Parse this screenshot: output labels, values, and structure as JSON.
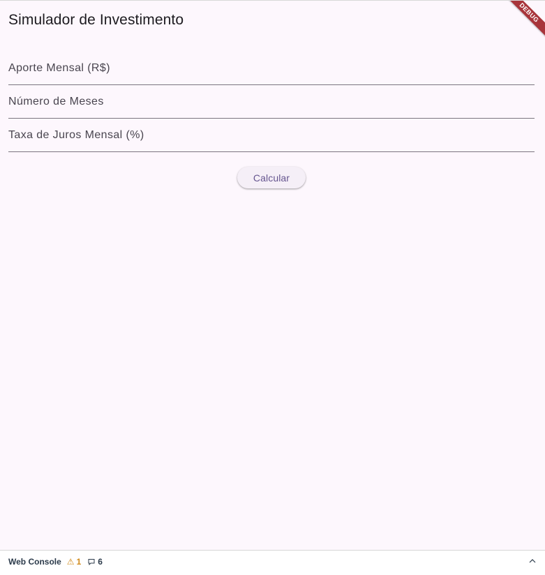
{
  "app": {
    "title": "Simulador de Investimento"
  },
  "form": {
    "fields": [
      {
        "label": "Aporte Mensal (R$)",
        "value": ""
      },
      {
        "label": "Número de Meses",
        "value": ""
      },
      {
        "label": "Taxa de Juros Mensal (%)",
        "value": ""
      }
    ],
    "calculate_label": "Calcular"
  },
  "debug_banner": {
    "label": "DEBUG",
    "color": "#a8343a"
  },
  "console": {
    "title": "Web Console",
    "warning_count": "1",
    "message_count": "6",
    "warning_icon": "warning-triangle-icon",
    "message_icon": "speech-bubble-icon",
    "toggle_icon": "chevron-up-icon"
  },
  "colors": {
    "background": "#fdf7fd",
    "accent": "#65558f",
    "button_bg": "#f5eff7"
  }
}
